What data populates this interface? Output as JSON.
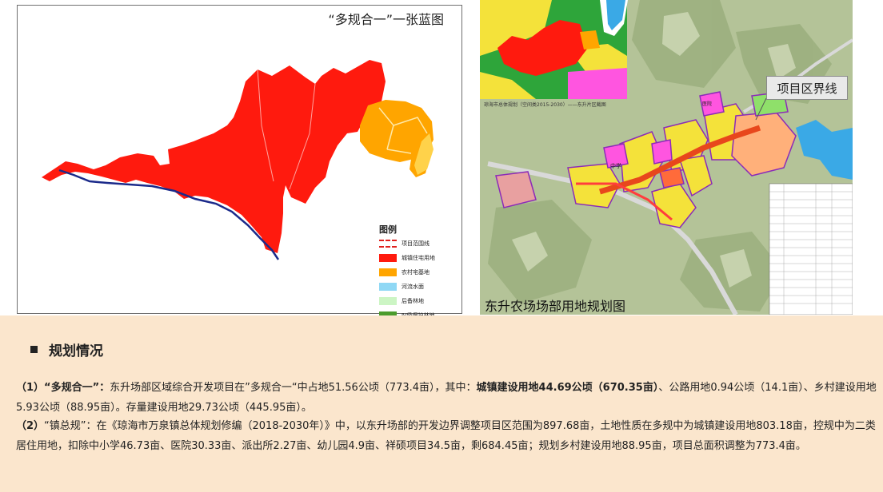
{
  "left_map": {
    "title": "“多规合一”一张蓝图",
    "legend": {
      "title": "图例",
      "items": [
        {
          "label": "项目范围线",
          "color": "#e0201c",
          "style": "dashed"
        },
        {
          "label": "城镇住宅用地",
          "color": "#ff1a0e"
        },
        {
          "label": "农村宅基地",
          "color": "#ffa500"
        },
        {
          "label": "河流水面",
          "color": "#8fd8f5"
        },
        {
          "label": "后备林地",
          "color": "#ccf5c4"
        },
        {
          "label": "Ⅳ级保护林地",
          "color": "#4b9c2c"
        }
      ]
    }
  },
  "right_map": {
    "inset_caption": "琼海市总体规划（空间类2015-2030）——东升片区截图",
    "callout": "项目区界线",
    "caption": "东升农场场部用地规划图",
    "labels": {
      "school": "中学",
      "hospital": "医院"
    }
  },
  "section": {
    "title": "规划情况",
    "p1": {
      "lead": "（1）“多规合一”：",
      "text_a": "东升场部区域综合开发项目在”多规合一“中占地51.56公顷（773.4亩），其中：",
      "bold": "城镇建设用地44.69公顷（670.35亩）",
      "text_b": "、公路用地0.94公顷（14.1亩）、乡村建设用地5.93公顷（88.95亩）。存量建设用地29.73公顷（445.95亩）。"
    },
    "p2": {
      "lead": "（2）",
      "text": "“镇总规”：在《琼海市万泉镇总体规划修编（2018-2030年）》中，以东升场部的开发边界调整项目区范围为897.68亩，土地性质在多规中为城镇建设用地803.18亩，控规中为二类居住用地，扣除中小学46.73亩、医院30.33亩、派出所2.27亩、幼儿园4.9亩、祥硕项目34.5亩，剩684.45亩；规划乡村建设用地88.95亩，项目总面积调整为773.4亩。"
    }
  }
}
